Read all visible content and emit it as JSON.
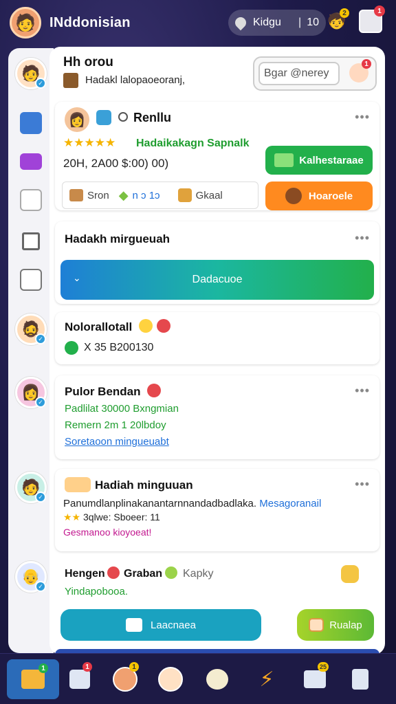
{
  "app": {
    "title": "INddonisian",
    "search_label": "Kidgu",
    "search_sep": "|",
    "search_count": "10",
    "top_badge_red": "1",
    "top_badge_yellow": "2"
  },
  "header": {
    "title": "Hh orou",
    "subtitle": "Hadakl lalopaoeoranj,",
    "search_value": "Bgar @nerey",
    "profile_badge": "1"
  },
  "profile_card": {
    "name": "Renllu",
    "rating_text": "Hadaikakagn Sapnalk",
    "stats": "20H, 2A00  $:00) 00)",
    "action_primary": "Kalhestaraae",
    "action_secondary": "Hoaroele",
    "chips": [
      {
        "label": "Sron"
      },
      {
        "label": "n ɔ 1ɔ"
      },
      {
        "label": "Gkaal"
      }
    ]
  },
  "weekly": {
    "title": "Hadakh mirgueuah",
    "dropdown_label": "Dadacuoe"
  },
  "reward": {
    "title": "Nolorallotall",
    "value": "X 35  B200130"
  },
  "friend1": {
    "title": "Pulor Bendan",
    "line1": "Padlilat 30000 Bxngmian",
    "line2": "Remern 2m 1 20lbdoy",
    "link": "Soretaoon mingueuabt"
  },
  "friend2": {
    "title": "Hadiah minguuan",
    "line1": "Panumdlanplinakanantarnnandadbadlaka.",
    "line1_link": "Mesagoranail",
    "line2": "3qlwe: Sboeer: 11",
    "line3": "Gesmanoo kioyoeat!"
  },
  "friend3": {
    "title_a": "Hengen",
    "title_b": "Graban",
    "title_c": "Kapky",
    "subtitle": "Yindapobooa.",
    "btn_primary": "Laacnaea",
    "btn_secondary": "Rualap"
  },
  "nav": {
    "badge_home": "1",
    "badge_msg": "1",
    "badge_avatar": "1",
    "badge_shop": "25"
  },
  "colors": {
    "accent_green": "#22b04b",
    "accent_orange": "#ff8a1f",
    "accent_teal": "#1aa2c0",
    "accent_blue": "#2b6bb8"
  }
}
